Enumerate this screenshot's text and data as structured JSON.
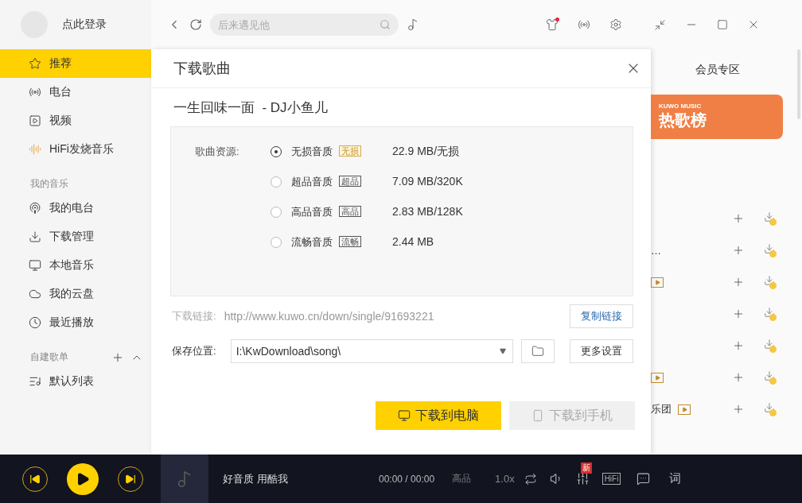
{
  "sidebar": {
    "login_label": "点此登录",
    "nav": [
      {
        "label": "推荐",
        "kind": "star",
        "selected": true
      },
      {
        "label": "电台",
        "kind": "radio",
        "selected": false
      },
      {
        "label": "视频",
        "kind": "video",
        "selected": false
      },
      {
        "label": "HiFi发烧音乐",
        "kind": "hifi",
        "selected": false
      }
    ],
    "sections": [
      {
        "title": "我的音乐",
        "kind": "plain",
        "items": [
          {
            "label": "我的电台",
            "kind": "podcast",
            "selected": false
          },
          {
            "label": "下载管理",
            "kind": "download",
            "selected": false
          },
          {
            "label": "本地音乐",
            "kind": "monitor",
            "selected": false
          },
          {
            "label": "我的云盘",
            "kind": "cloud",
            "selected": false
          },
          {
            "label": "最近播放",
            "kind": "clock",
            "selected": false
          }
        ]
      },
      {
        "title": "自建歌单",
        "kind": "playlists",
        "items": [
          {
            "label": "默认列表",
            "kind": "list",
            "selected": false
          }
        ]
      }
    ]
  },
  "topbar": {
    "search": {
      "placeholder": "后来遇见他"
    }
  },
  "dialog": {
    "title": "下载歌曲",
    "song": "一生回味一面  - DJ小鱼儿",
    "quality_label": "歌曲资源:",
    "options": [
      {
        "label": "无损音质",
        "badge": "无损",
        "premium": true,
        "size": "22.9 MB/无损",
        "selected": true
      },
      {
        "label": "超品音质",
        "badge": "超品",
        "premium": false,
        "size": "7.09 MB/320K",
        "selected": false
      },
      {
        "label": "高品音质",
        "badge": "高品",
        "premium": false,
        "size": "2.83 MB/128K",
        "selected": false
      },
      {
        "label": "流畅音质",
        "badge": "流畅",
        "premium": false,
        "size": "2.44 MB",
        "selected": false
      }
    ],
    "link_label": "下载链接:",
    "link_url": "http://www.kuwo.cn/down/single/91693221",
    "copy_button": "复制链接",
    "save_label": "保存位置:",
    "save_path": "I:\\KwDownload\\song\\",
    "more_button": "更多设置",
    "buttons": [
      {
        "label": "下载到电脑",
        "kind": "computer",
        "disabled": false
      },
      {
        "label": "下载到手机",
        "kind": "phone",
        "disabled": true
      }
    ]
  },
  "background": {
    "tab": "会员专区",
    "banner": {
      "brand": "KUWO MUSIC",
      "title": "热歌榜"
    },
    "rows": [
      {
        "mv": false
      },
      {
        "text": "…",
        "mv": false
      },
      {
        "mv": true
      },
      {
        "mv": false
      },
      {
        "mv": false
      },
      {
        "mv": true
      },
      {
        "text": "乐团",
        "mv": true
      }
    ]
  },
  "player": {
    "now_playing": "好音质 用酷我",
    "time": "00:00 / 00:00",
    "quality": "高品",
    "speed": "1.0x",
    "new_badge": "新",
    "hifi": "HiFi",
    "lyrics": "词"
  }
}
